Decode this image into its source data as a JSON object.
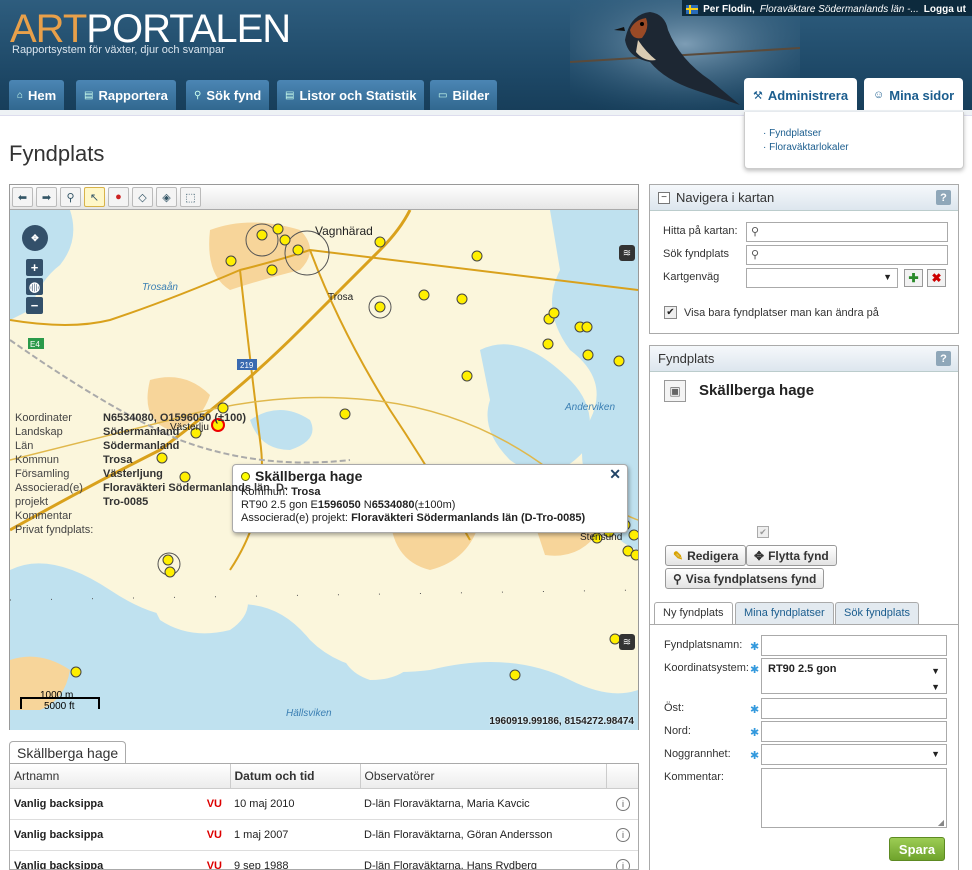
{
  "header": {
    "logo_part1": "ART",
    "logo_part2": "PORTALEN",
    "tagline": "Rapportsystem för växter, djur och svampar",
    "user_name": "Per Flodin,",
    "user_project": "Floraväktare Södermanlands län -...",
    "logout": "Logga ut"
  },
  "nav": {
    "items": [
      "Hem",
      "Rapportera",
      "Sök fynd",
      "Listor och Statistik",
      "Bilder"
    ],
    "right_items": [
      "Administrera",
      "Mina sidor"
    ],
    "submenu": [
      "· Fyndplatser",
      "· Floraväktarlokaler"
    ]
  },
  "page_title": "Fyndplats",
  "map": {
    "labels": {
      "vagnharad": "Vagnhärad",
      "trosa": "Trosa",
      "trosaan": "Trosaån",
      "vasterljung": "Västerlju",
      "anderviken": "Anderviken",
      "hallsviken": "Hällsviken",
      "stensund": "Stensund",
      "e4": "E4",
      "r219": "219"
    },
    "popup": {
      "title": "Skällberga hage",
      "line1_label": "Kommun:",
      "line1_value": "Trosa",
      "line2_a": "RT90 2.5 gon E",
      "line2_b": "1596050",
      "line2_c": " N",
      "line2_d": "6534080",
      "line2_e": "(±100m)",
      "line3_label": "Associerad(e) projekt:",
      "line3_value": "Floraväkteri Södermanlands län (D-Tro-0085)"
    },
    "scale_m": "1000 m",
    "scale_ft": "5000 ft",
    "coords": "1960919.99186, 8154272.98474"
  },
  "bottom": {
    "tab": "Skällberga hage",
    "columns": [
      "Artnamn",
      "Datum och tid",
      "Observatörer",
      ""
    ],
    "rows": [
      {
        "species": "Vanlig backsippa",
        "status": "VU",
        "date": "10 maj 2010",
        "observers": "D-län Floraväktarna, Maria Kavcic"
      },
      {
        "species": "Vanlig backsippa",
        "status": "VU",
        "date": "1 maj 2007",
        "observers": "D-län Floraväktarna, Göran Andersson"
      },
      {
        "species": "Vanlig backsippa",
        "status": "VU",
        "date": "9 sep 1988",
        "observers": "D-län Floraväktarna, Hans Rydberg"
      }
    ]
  },
  "nav_panel": {
    "title": "Navigera i kartan",
    "find_label": "Hitta på kartan:",
    "search_label": "Sök fyndplats",
    "shortcut_label": "Kartgenväg",
    "checkbox_label": "Visa bara fyndplatser man kan ändra på"
  },
  "site_panel": {
    "title": "Fyndplats",
    "name": "Skällberga hage",
    "fields": [
      {
        "label": "Koordinater",
        "value": "N6534080, O1596050  (±100)"
      },
      {
        "label": "Landskap",
        "value": "Södermanland"
      },
      {
        "label": "Län",
        "value": "Södermanland"
      },
      {
        "label": "Kommun",
        "value": "Trosa"
      },
      {
        "label": "Församling",
        "value": "Västerljung"
      },
      {
        "label": "Associerad(e) projekt",
        "value": "Floraväkteri Södermanlands län, D-Tro-0085"
      },
      {
        "label": "Kommentar",
        "value": ""
      },
      {
        "label": "Privat fyndplats:",
        "value": ""
      }
    ],
    "btn_edit": "Redigera",
    "btn_move": "Flytta fynd",
    "btn_view": "Visa fyndplatsens fynd"
  },
  "form": {
    "tabs": [
      "Ny fyndplats",
      "Mina fyndplatser",
      "Sök fyndplats"
    ],
    "name_label": "Fyndplatsnamn:",
    "coordsys_label": "Koordinatsystem:",
    "coordsys_value": "RT90 2.5 gon",
    "east_label": "Öst:",
    "north_label": "Nord:",
    "accuracy_label": "Noggrannhet:",
    "comment_label": "Kommentar:",
    "save": "Spara"
  }
}
